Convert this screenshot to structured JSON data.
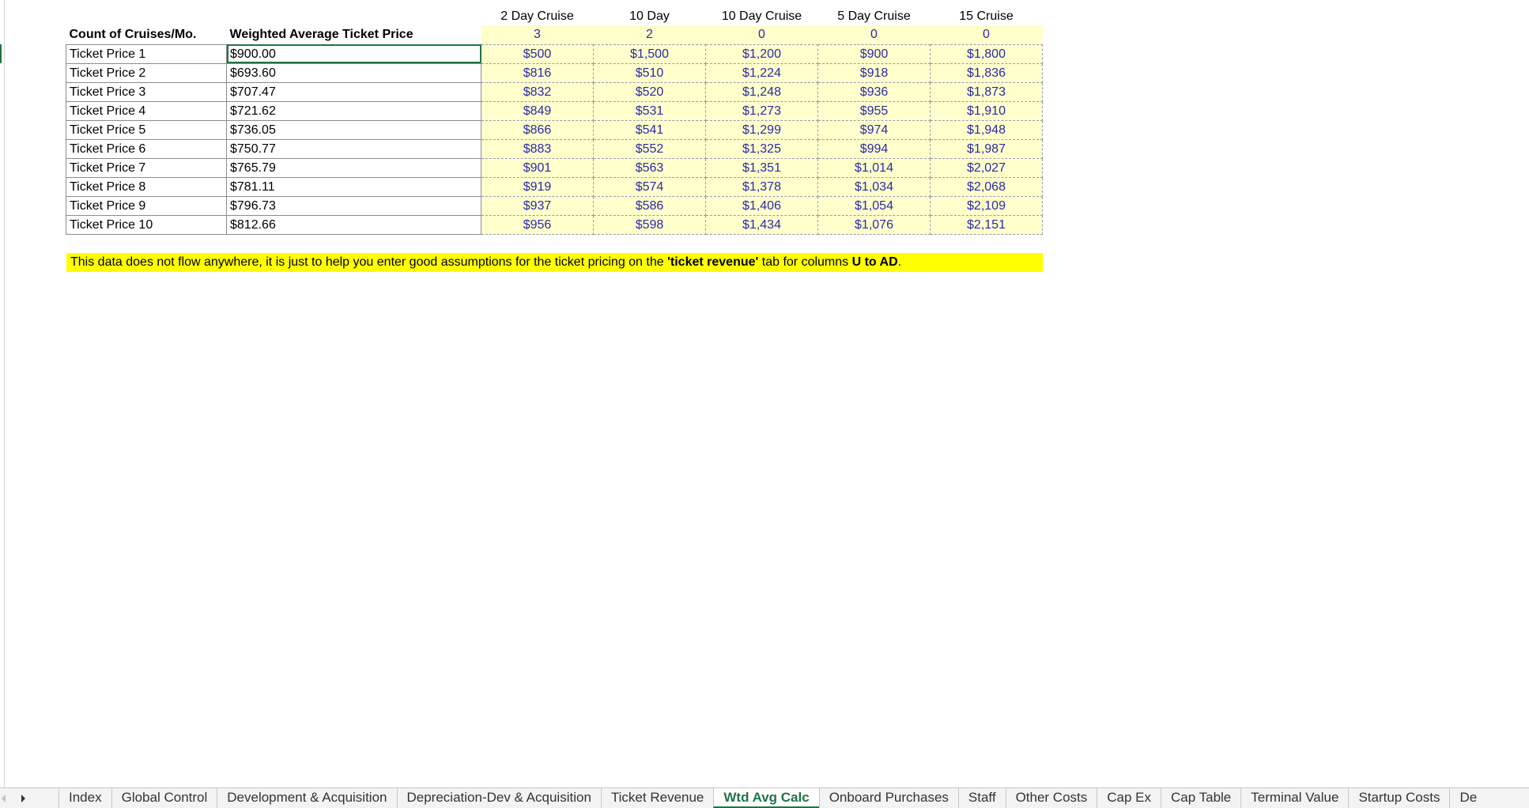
{
  "columns": {
    "a_header": "Count of Cruises/Mo.",
    "b_header": "Weighted Average Ticket Price",
    "cruise_types": [
      "2 Day Cruise",
      "10 Day",
      "10 Day Cruise",
      "5 Day Cruise",
      "15 Cruise"
    ],
    "counts": [
      "3",
      "2",
      "0",
      "0",
      "0"
    ]
  },
  "rows": [
    {
      "label": "Ticket Price 1",
      "wavg": "$900.00",
      "prices": [
        "$500",
        "$1,500",
        "$1,200",
        "$900",
        "$1,800"
      ]
    },
    {
      "label": "Ticket Price 2",
      "wavg": "$693.60",
      "prices": [
        "$816",
        "$510",
        "$1,224",
        "$918",
        "$1,836"
      ]
    },
    {
      "label": "Ticket Price 3",
      "wavg": "$707.47",
      "prices": [
        "$832",
        "$520",
        "$1,248",
        "$936",
        "$1,873"
      ]
    },
    {
      "label": "Ticket Price 4",
      "wavg": "$721.62",
      "prices": [
        "$849",
        "$531",
        "$1,273",
        "$955",
        "$1,910"
      ]
    },
    {
      "label": "Ticket Price 5",
      "wavg": "$736.05",
      "prices": [
        "$866",
        "$541",
        "$1,299",
        "$974",
        "$1,948"
      ]
    },
    {
      "label": "Ticket Price 6",
      "wavg": "$750.77",
      "prices": [
        "$883",
        "$552",
        "$1,325",
        "$994",
        "$1,987"
      ]
    },
    {
      "label": "Ticket Price 7",
      "wavg": "$765.79",
      "prices": [
        "$901",
        "$563",
        "$1,351",
        "$1,014",
        "$2,027"
      ]
    },
    {
      "label": "Ticket Price 8",
      "wavg": "$781.11",
      "prices": [
        "$919",
        "$574",
        "$1,378",
        "$1,034",
        "$2,068"
      ]
    },
    {
      "label": "Ticket Price 9",
      "wavg": "$796.73",
      "prices": [
        "$937",
        "$586",
        "$1,406",
        "$1,054",
        "$2,109"
      ]
    },
    {
      "label": "Ticket Price 10",
      "wavg": "$812.66",
      "prices": [
        "$956",
        "$598",
        "$1,434",
        "$1,076",
        "$2,151"
      ]
    }
  ],
  "note": {
    "prefix": "This data does not flow anywhere, it is just to help you enter good assumptions for the ticket pricing on the ",
    "bold_tab": "'ticket revenue'",
    "middle": " tab for columns ",
    "bold_cols": "U to AD",
    "suffix": "."
  },
  "sheet_tabs": [
    "Index",
    "Global Control",
    "Development & Acquisition",
    "Depreciation-Dev & Acquisition",
    "Ticket Revenue",
    "Wtd Avg Calc",
    "Onboard Purchases",
    "Staff",
    "Other Costs",
    "Cap Ex",
    "Cap Table",
    "Terminal Value",
    "Startup Costs",
    "De"
  ],
  "active_tab": "Wtd Avg Calc",
  "colors": {
    "accent": "#217346",
    "input_fill": "#ffffcc",
    "input_text": "#2a2aa8",
    "note_fill": "#ffff00"
  }
}
